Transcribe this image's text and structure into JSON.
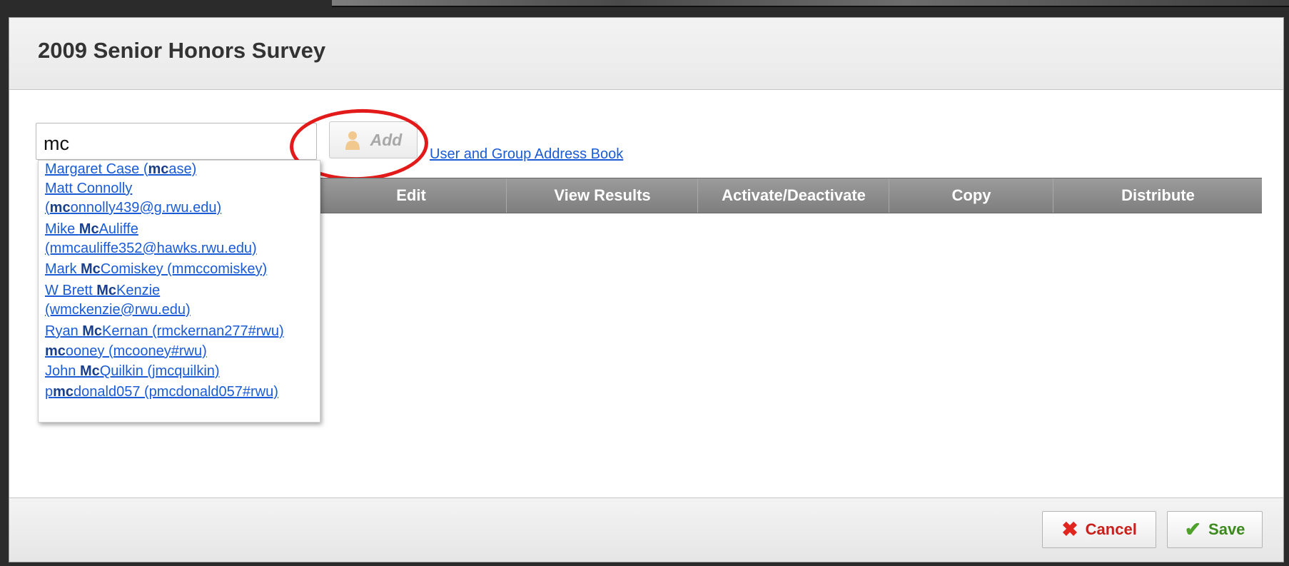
{
  "dialog": {
    "title": "2009 Senior Honors Survey"
  },
  "search": {
    "value": "mc",
    "add_label": "Add",
    "address_book_link": "User and Group Address Book"
  },
  "table": {
    "columns": [
      "Edit",
      "View Results",
      "Activate/Deactivate",
      "Copy",
      "Distribute"
    ]
  },
  "suggestions": [
    {
      "lines": [
        [
          {
            "t": "Margaret Case (",
            "b": false
          },
          {
            "t": "mc",
            "b": true
          },
          {
            "t": "ase)",
            "b": false
          }
        ]
      ]
    },
    {
      "lines": [
        [
          {
            "t": "Matt Connolly",
            "b": false
          }
        ],
        [
          {
            "t": "(",
            "b": false
          },
          {
            "t": "mc",
            "b": true
          },
          {
            "t": "onnolly439@g.rwu.edu)",
            "b": false
          }
        ]
      ]
    },
    {
      "lines": [
        [
          {
            "t": "Mike ",
            "b": false
          },
          {
            "t": "Mc",
            "b": true
          },
          {
            "t": "Auliffe",
            "b": false
          }
        ],
        [
          {
            "t": "(mmcauliffe352@hawks.rwu.edu)",
            "b": false
          }
        ]
      ]
    },
    {
      "lines": [
        [
          {
            "t": "Mark ",
            "b": false
          },
          {
            "t": "Mc",
            "b": true
          },
          {
            "t": "Comiskey (mmccomiskey)",
            "b": false
          }
        ]
      ]
    },
    {
      "lines": [
        [
          {
            "t": "W Brett ",
            "b": false
          },
          {
            "t": "Mc",
            "b": true
          },
          {
            "t": "Kenzie",
            "b": false
          }
        ],
        [
          {
            "t": "(wmckenzie@rwu.edu)",
            "b": false
          }
        ]
      ]
    },
    {
      "lines": [
        [
          {
            "t": "Ryan ",
            "b": false
          },
          {
            "t": "Mc",
            "b": true
          },
          {
            "t": "Kernan (rmckernan277#rwu)",
            "b": false
          }
        ]
      ]
    },
    {
      "lines": [
        [
          {
            "t": "mc",
            "b": true
          },
          {
            "t": "ooney (mcooney#rwu)",
            "b": false
          }
        ]
      ]
    },
    {
      "lines": [
        [
          {
            "t": "John ",
            "b": false
          },
          {
            "t": "Mc",
            "b": true
          },
          {
            "t": "Quilkin (jmcquilkin)",
            "b": false
          }
        ]
      ]
    },
    {
      "lines": [
        [
          {
            "t": "p",
            "b": false
          },
          {
            "t": "mc",
            "b": true
          },
          {
            "t": "donald057 (pmcdonald057#rwu)",
            "b": false
          }
        ]
      ]
    }
  ],
  "footer": {
    "cancel_label": "Cancel",
    "save_label": "Save"
  },
  "icons": {
    "add": "person-icon",
    "cancel": "x-icon",
    "save": "checkmark-icon"
  },
  "colors": {
    "link": "#1a5bd6",
    "cancel": "#c8201a",
    "save": "#3c8a1e",
    "highlight": "#e21a1a"
  }
}
